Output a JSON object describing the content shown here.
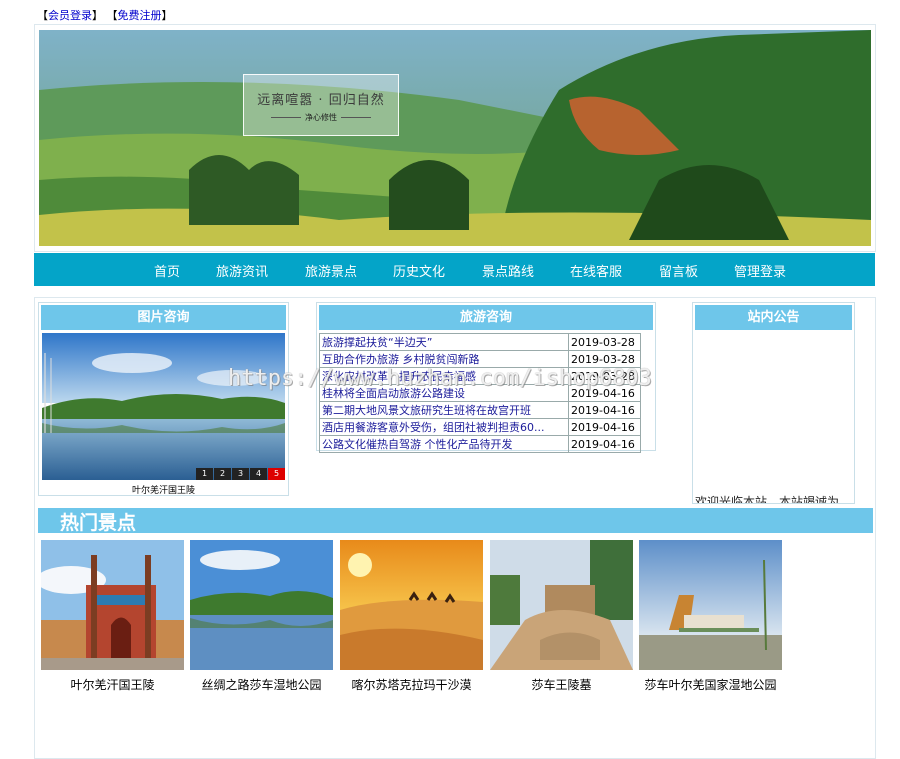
{
  "toplinks": {
    "lb1": "【",
    "login": "会员登录",
    "rb1": "】",
    "lb2": "【",
    "register": "免费注册",
    "rb2": "】"
  },
  "banner": {
    "title": "远离喧嚣 · 回归自然",
    "subtitle": "净心修性"
  },
  "nav": [
    "首页",
    "旅游资讯",
    "旅游景点",
    "历史文化",
    "景点路线",
    "在线客服",
    "留言板",
    "管理登录"
  ],
  "pic_panel": {
    "title": "图片咨询",
    "caption": "叶尔羌汗国王陵",
    "dots": [
      "1",
      "2",
      "3",
      "4",
      "5"
    ],
    "active_dot": 5
  },
  "news_panel": {
    "title": "旅游咨询",
    "rows": [
      {
        "title": "旅游撑起扶贫“半边天”",
        "date": "2019-03-28"
      },
      {
        "title": "互助合作办旅游 乡村脱贫闯新路",
        "date": "2019-03-28"
      },
      {
        "title": "深化农村改革，提升农民幸福感",
        "date": "2019-03-28"
      },
      {
        "title": "桂林将全面启动旅游公路建设",
        "date": "2019-04-16"
      },
      {
        "title": "第二期大地风景文旅研究生班将在故宫开班",
        "date": "2019-04-16"
      },
      {
        "title": "酒店用餐游客意外受伤，组团社被判担责60...",
        "date": "2019-04-16"
      },
      {
        "title": "公路文化催热自驾游 个性化产品待开发",
        "date": "2019-04-16"
      }
    ]
  },
  "notice_panel": {
    "title": "站内公告",
    "text": "欢迎光临本站，本站竭诚为"
  },
  "hot": {
    "title": "热门景点",
    "items": [
      {
        "caption": "叶尔羌汗国王陵",
        "icon": "mosque-photo"
      },
      {
        "caption": "丝绸之路莎车湿地公园",
        "icon": "lake-photo"
      },
      {
        "caption": "喀尔苏塔克拉玛干沙漠",
        "icon": "desert-photo"
      },
      {
        "caption": "莎车王陵墓",
        "icon": "tomb-photo"
      },
      {
        "caption": "莎车叶尔羌国家湿地公园",
        "icon": "park-gate-photo"
      }
    ]
  },
  "watermark": "https://www.huzhan.com/ishop6803",
  "colors": {
    "nav": "#04a4c8",
    "panel_head": "#6ec6ea",
    "link": "#1a1a99"
  }
}
